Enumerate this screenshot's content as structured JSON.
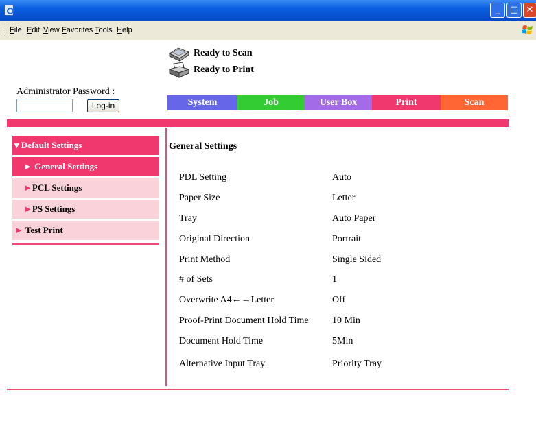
{
  "menu": [
    "File",
    "Edit",
    "View",
    "Favorites",
    "Tools",
    "Help"
  ],
  "status": {
    "scan": "Ready to Scan",
    "print": "Ready to Print"
  },
  "login": {
    "label": "Administrator Password :",
    "button": "Log-in",
    "password_value": ""
  },
  "tabs": [
    "System",
    "Job",
    "User Box",
    "Print",
    "Scan"
  ],
  "sidebar": {
    "default_settings": "Default Settings",
    "general_settings": "General Settings",
    "pcl_settings": "PCL Settings",
    "ps_settings": "PS Settings",
    "test_print": "Test Print"
  },
  "content": {
    "title": "General Settings",
    "rows": [
      {
        "label": "PDL Setting",
        "value": "Auto"
      },
      {
        "label": "Paper Size",
        "value": "Letter"
      },
      {
        "label": "Tray",
        "value": "Auto Paper"
      },
      {
        "label": "Original Direction",
        "value": "Portrait"
      },
      {
        "label": "Print Method",
        "value": "Single Sided"
      },
      {
        "label": "# of Sets",
        "value": "1"
      },
      {
        "label": "Overwrite A4←→Letter",
        "value": "Off"
      },
      {
        "label": "Proof-Print Document Hold Time",
        "value": "10 Min"
      },
      {
        "label": "Document Hold Time",
        "value": "5Min"
      },
      {
        "label": "Alternative Input Tray",
        "value": "Priority Tray"
      }
    ]
  },
  "colors": {
    "titlebar": "#0a5fe0",
    "accent_pink": "#f0376e",
    "nav_inactive": "#fad2d9",
    "tab_system": "#6666e8",
    "tab_job": "#33cc33",
    "tab_user_box": "#a36be8",
    "tab_print": "#f0376e",
    "tab_scan": "#ff6633"
  },
  "icons": [
    "ie-icon",
    "minimize-icon",
    "maximize-icon",
    "close-icon",
    "windows-logo-icon",
    "scanner-icon",
    "printer-icon",
    "triangle-down-icon",
    "triangle-right-icon"
  ]
}
